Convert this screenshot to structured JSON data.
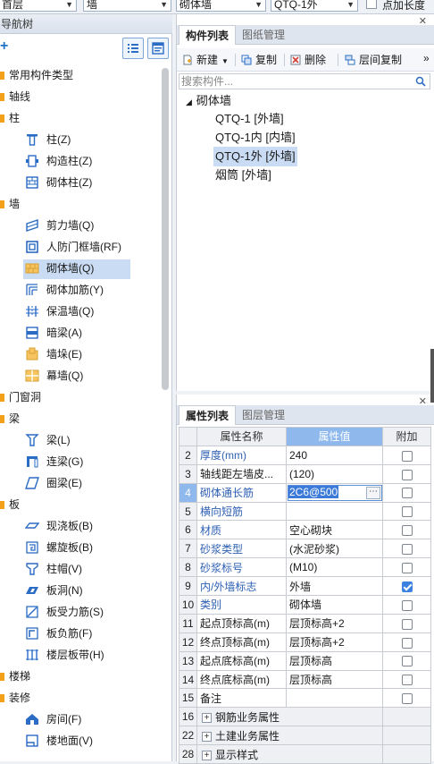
{
  "topbar": {
    "floor_combo": "首层",
    "type_combo": "墙",
    "subtype_combo": "砌体墙",
    "component_combo": "QTQ-1外",
    "point_length_label": "点加长度"
  },
  "left_nav": {
    "title": "导航树",
    "categories": [
      {
        "label": "常用构件类型"
      },
      {
        "label": "轴线"
      },
      {
        "label": "柱"
      },
      {
        "label": "墙"
      },
      {
        "label": "门窗洞"
      },
      {
        "label": "梁"
      },
      {
        "label": "板"
      },
      {
        "label": "楼梯"
      },
      {
        "label": "装修"
      }
    ],
    "items": [
      {
        "label": "柱(Z)",
        "icon": "column-icon"
      },
      {
        "label": "构造柱(Z)",
        "icon": "construct-column-icon"
      },
      {
        "label": "砌体柱(Z)",
        "icon": "masonry-column-icon"
      },
      {
        "label": "剪力墙(Q)",
        "icon": "shear-wall-icon"
      },
      {
        "label": "人防门框墙(RF)",
        "icon": "defense-door-wall-icon"
      },
      {
        "label": "砌体墙(Q)",
        "icon": "masonry-wall-icon"
      },
      {
        "label": "砌体加筋(Y)",
        "icon": "masonry-rebar-icon"
      },
      {
        "label": "保温墙(Q)",
        "icon": "insulation-wall-icon"
      },
      {
        "label": "暗梁(A)",
        "icon": "hidden-beam-icon"
      },
      {
        "label": "墙垛(E)",
        "icon": "wall-pier-icon"
      },
      {
        "label": "幕墙(Q)",
        "icon": "curtain-wall-icon"
      },
      {
        "label": "梁(L)",
        "icon": "beam-icon"
      },
      {
        "label": "连梁(G)",
        "icon": "coupling-beam-icon"
      },
      {
        "label": "圈梁(E)",
        "icon": "ring-beam-icon"
      },
      {
        "label": "现浇板(B)",
        "icon": "cast-slab-icon"
      },
      {
        "label": "螺旋板(B)",
        "icon": "spiral-slab-icon"
      },
      {
        "label": "柱帽(V)",
        "icon": "column-cap-icon"
      },
      {
        "label": "板洞(N)",
        "icon": "slab-hole-icon"
      },
      {
        "label": "板受力筋(S)",
        "icon": "slab-main-rebar-icon"
      },
      {
        "label": "板负筋(F)",
        "icon": "slab-neg-rebar-icon"
      },
      {
        "label": "楼层板带(H)",
        "icon": "floor-strip-icon"
      },
      {
        "label": "房间(F)",
        "icon": "room-icon"
      },
      {
        "label": "楼地面(V)",
        "icon": "floor-icon"
      }
    ]
  },
  "component_panel": {
    "tabs": [
      {
        "label": "构件列表"
      },
      {
        "label": "图纸管理"
      }
    ],
    "toolbar": {
      "new_label": "新建",
      "copy_label": "复制",
      "delete_label": "删除",
      "floor_copy_label": "层间复制"
    },
    "search_placeholder": "搜索构件...",
    "tree": {
      "root": "砌体墙",
      "children": [
        {
          "label": "QTQ-1 [外墙]"
        },
        {
          "label": "QTQ-1内 [内墙]"
        },
        {
          "label": "QTQ-1外 [外墙]"
        },
        {
          "label": "烟筒 [外墙]"
        }
      ]
    }
  },
  "property_panel": {
    "tabs": [
      {
        "label": "属性列表"
      },
      {
        "label": "图层管理"
      }
    ],
    "headers": {
      "num": "",
      "name": "属性名称",
      "value": "属性值",
      "extra": "附加"
    },
    "rows": [
      {
        "num": "2",
        "name": "厚度(mm)",
        "value": "240"
      },
      {
        "num": "3",
        "name": "轴线距左墙皮...",
        "value": "(120)"
      },
      {
        "num": "4",
        "name": "砌体通长筋",
        "value": "2C6@500"
      },
      {
        "num": "5",
        "name": "横向短筋",
        "value": ""
      },
      {
        "num": "6",
        "name": "材质",
        "value": "空心砌块"
      },
      {
        "num": "7",
        "name": "砂浆类型",
        "value": "(水泥砂浆)"
      },
      {
        "num": "8",
        "name": "砂浆标号",
        "value": "(M10)"
      },
      {
        "num": "9",
        "name": "内/外墙标志",
        "value": "外墙"
      },
      {
        "num": "10",
        "name": "类别",
        "value": "砌体墙"
      },
      {
        "num": "11",
        "name": "起点顶标高(m)",
        "value": "层顶标高+2"
      },
      {
        "num": "12",
        "name": "终点顶标高(m)",
        "value": "层顶标高+2"
      },
      {
        "num": "13",
        "name": "起点底标高(m)",
        "value": "层顶标高"
      },
      {
        "num": "14",
        "name": "终点底标高(m)",
        "value": "层顶标高"
      },
      {
        "num": "15",
        "name": "备注",
        "value": ""
      }
    ],
    "groups": [
      {
        "num": "16",
        "name": "钢筋业务属性"
      },
      {
        "num": "22",
        "name": "土建业务属性"
      },
      {
        "num": "28",
        "name": "显示样式"
      }
    ]
  },
  "colors": {
    "selection": "#c9dcf3",
    "accent": "#8fb8ec",
    "blue_text": "#2d5fb3",
    "category_marker": "#f3a01b"
  }
}
